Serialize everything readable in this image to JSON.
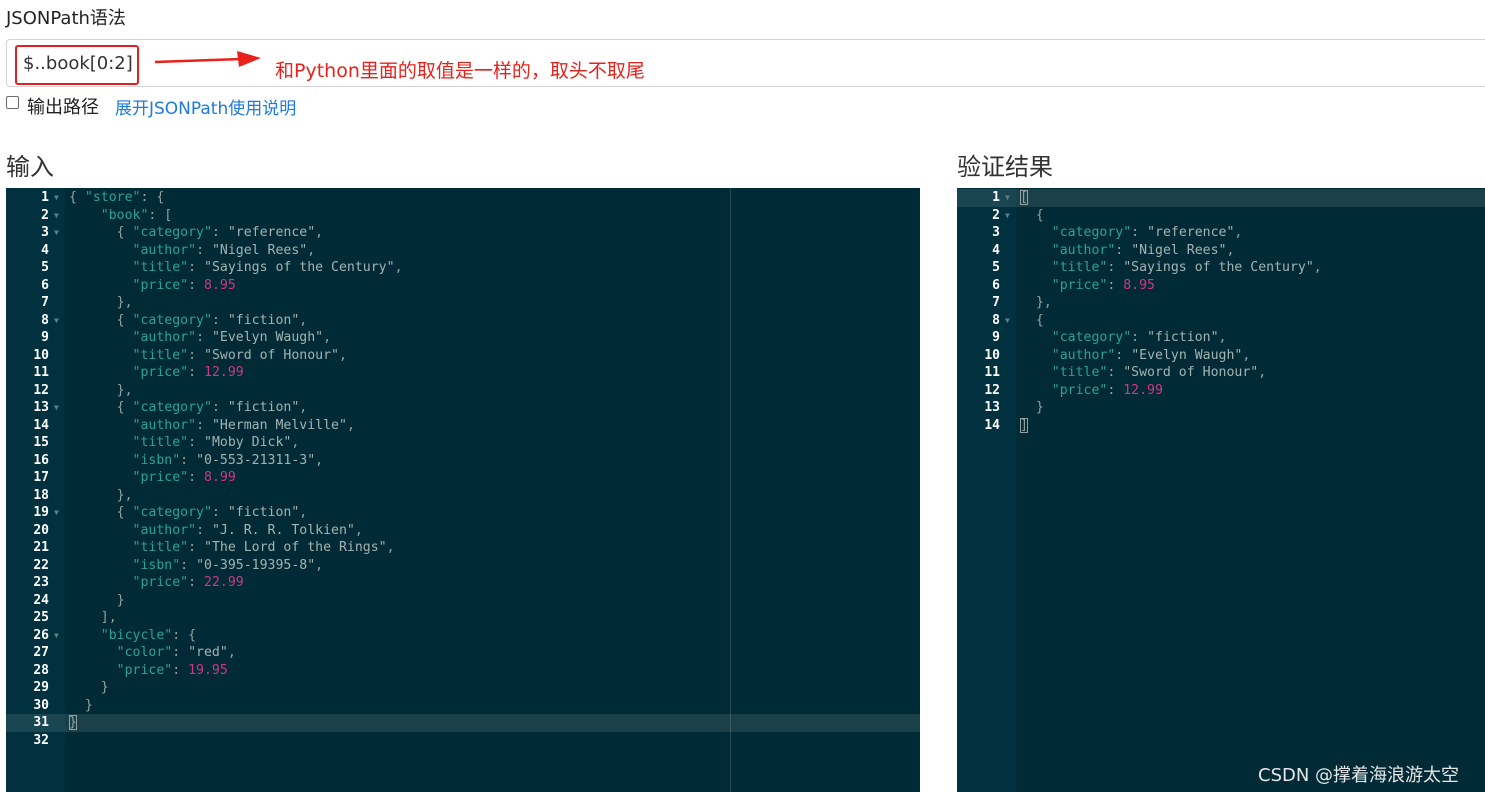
{
  "header": {
    "title": "JSONPath语法"
  },
  "query": {
    "value": "$..book[0:2]"
  },
  "annotation": {
    "text": "和Python里面的取值是一样的，取头不取尾",
    "color": "#e8211b"
  },
  "options": {
    "output_path_label": "输出路径",
    "output_path_checked": false,
    "doc_link": "展开JSONPath使用说明"
  },
  "input_panel": {
    "title": "输入",
    "active_line": 31,
    "lines": [
      [
        {
          "t": "br",
          "v": "{"
        },
        {
          "t": "p",
          "v": " "
        },
        {
          "t": "k",
          "v": "\"store\""
        },
        {
          "t": "p",
          "v": ": {"
        }
      ],
      [
        {
          "t": "p",
          "v": "    "
        },
        {
          "t": "k",
          "v": "\"book\""
        },
        {
          "t": "p",
          "v": ": ["
        }
      ],
      [
        {
          "t": "p",
          "v": "      { "
        },
        {
          "t": "k",
          "v": "\"category\""
        },
        {
          "t": "p",
          "v": ": "
        },
        {
          "t": "s",
          "v": "\"reference\""
        },
        {
          "t": "p",
          "v": ","
        }
      ],
      [
        {
          "t": "p",
          "v": "        "
        },
        {
          "t": "k",
          "v": "\"author\""
        },
        {
          "t": "p",
          "v": ": "
        },
        {
          "t": "s",
          "v": "\"Nigel Rees\""
        },
        {
          "t": "p",
          "v": ","
        }
      ],
      [
        {
          "t": "p",
          "v": "        "
        },
        {
          "t": "k",
          "v": "\"title\""
        },
        {
          "t": "p",
          "v": ": "
        },
        {
          "t": "s",
          "v": "\"Sayings of the Century\""
        },
        {
          "t": "p",
          "v": ","
        }
      ],
      [
        {
          "t": "p",
          "v": "        "
        },
        {
          "t": "k",
          "v": "\"price\""
        },
        {
          "t": "p",
          "v": ": "
        },
        {
          "t": "n",
          "v": "8.95"
        }
      ],
      [
        {
          "t": "p",
          "v": "      },"
        }
      ],
      [
        {
          "t": "p",
          "v": "      { "
        },
        {
          "t": "k",
          "v": "\"category\""
        },
        {
          "t": "p",
          "v": ": "
        },
        {
          "t": "s",
          "v": "\"fiction\""
        },
        {
          "t": "p",
          "v": ","
        }
      ],
      [
        {
          "t": "p",
          "v": "        "
        },
        {
          "t": "k",
          "v": "\"author\""
        },
        {
          "t": "p",
          "v": ": "
        },
        {
          "t": "s",
          "v": "\"Evelyn Waugh\""
        },
        {
          "t": "p",
          "v": ","
        }
      ],
      [
        {
          "t": "p",
          "v": "        "
        },
        {
          "t": "k",
          "v": "\"title\""
        },
        {
          "t": "p",
          "v": ": "
        },
        {
          "t": "s",
          "v": "\"Sword of Honour\""
        },
        {
          "t": "p",
          "v": ","
        }
      ],
      [
        {
          "t": "p",
          "v": "        "
        },
        {
          "t": "k",
          "v": "\"price\""
        },
        {
          "t": "p",
          "v": ": "
        },
        {
          "t": "n",
          "v": "12.99"
        }
      ],
      [
        {
          "t": "p",
          "v": "      },"
        }
      ],
      [
        {
          "t": "p",
          "v": "      { "
        },
        {
          "t": "k",
          "v": "\"category\""
        },
        {
          "t": "p",
          "v": ": "
        },
        {
          "t": "s",
          "v": "\"fiction\""
        },
        {
          "t": "p",
          "v": ","
        }
      ],
      [
        {
          "t": "p",
          "v": "        "
        },
        {
          "t": "k",
          "v": "\"author\""
        },
        {
          "t": "p",
          "v": ": "
        },
        {
          "t": "s",
          "v": "\"Herman Melville\""
        },
        {
          "t": "p",
          "v": ","
        }
      ],
      [
        {
          "t": "p",
          "v": "        "
        },
        {
          "t": "k",
          "v": "\"title\""
        },
        {
          "t": "p",
          "v": ": "
        },
        {
          "t": "s",
          "v": "\"Moby Dick\""
        },
        {
          "t": "p",
          "v": ","
        }
      ],
      [
        {
          "t": "p",
          "v": "        "
        },
        {
          "t": "k",
          "v": "\"isbn\""
        },
        {
          "t": "p",
          "v": ": "
        },
        {
          "t": "s",
          "v": "\"0-553-21311-3\""
        },
        {
          "t": "p",
          "v": ","
        }
      ],
      [
        {
          "t": "p",
          "v": "        "
        },
        {
          "t": "k",
          "v": "\"price\""
        },
        {
          "t": "p",
          "v": ": "
        },
        {
          "t": "n",
          "v": "8.99"
        }
      ],
      [
        {
          "t": "p",
          "v": "      },"
        }
      ],
      [
        {
          "t": "p",
          "v": "      { "
        },
        {
          "t": "k",
          "v": "\"category\""
        },
        {
          "t": "p",
          "v": ": "
        },
        {
          "t": "s",
          "v": "\"fiction\""
        },
        {
          "t": "p",
          "v": ","
        }
      ],
      [
        {
          "t": "p",
          "v": "        "
        },
        {
          "t": "k",
          "v": "\"author\""
        },
        {
          "t": "p",
          "v": ": "
        },
        {
          "t": "s",
          "v": "\"J. R. R. Tolkien\""
        },
        {
          "t": "p",
          "v": ","
        }
      ],
      [
        {
          "t": "p",
          "v": "        "
        },
        {
          "t": "k",
          "v": "\"title\""
        },
        {
          "t": "p",
          "v": ": "
        },
        {
          "t": "s",
          "v": "\"The Lord of the Rings\""
        },
        {
          "t": "p",
          "v": ","
        }
      ],
      [
        {
          "t": "p",
          "v": "        "
        },
        {
          "t": "k",
          "v": "\"isbn\""
        },
        {
          "t": "p",
          "v": ": "
        },
        {
          "t": "s",
          "v": "\"0-395-19395-8\""
        },
        {
          "t": "p",
          "v": ","
        }
      ],
      [
        {
          "t": "p",
          "v": "        "
        },
        {
          "t": "k",
          "v": "\"price\""
        },
        {
          "t": "p",
          "v": ": "
        },
        {
          "t": "n",
          "v": "22.99"
        }
      ],
      [
        {
          "t": "p",
          "v": "      }"
        }
      ],
      [
        {
          "t": "p",
          "v": "    ],"
        }
      ],
      [
        {
          "t": "p",
          "v": "    "
        },
        {
          "t": "k",
          "v": "\"bicycle\""
        },
        {
          "t": "p",
          "v": ": {"
        }
      ],
      [
        {
          "t": "p",
          "v": "      "
        },
        {
          "t": "k",
          "v": "\"color\""
        },
        {
          "t": "p",
          "v": ": "
        },
        {
          "t": "s",
          "v": "\"red\""
        },
        {
          "t": "p",
          "v": ","
        }
      ],
      [
        {
          "t": "p",
          "v": "      "
        },
        {
          "t": "k",
          "v": "\"price\""
        },
        {
          "t": "p",
          "v": ": "
        },
        {
          "t": "n",
          "v": "19.95"
        }
      ],
      [
        {
          "t": "p",
          "v": "    }"
        }
      ],
      [
        {
          "t": "p",
          "v": "  }"
        }
      ],
      [
        {
          "t": "brc",
          "v": "}"
        }
      ],
      []
    ],
    "fold_lines": [
      1,
      2,
      3,
      8,
      13,
      19,
      26
    ]
  },
  "result_panel": {
    "title": "验证结果",
    "active_line": 1,
    "lines": [
      [
        {
          "t": "brc",
          "v": "["
        }
      ],
      [
        {
          "t": "p",
          "v": "  {"
        }
      ],
      [
        {
          "t": "p",
          "v": "    "
        },
        {
          "t": "k",
          "v": "\"category\""
        },
        {
          "t": "p",
          "v": ": "
        },
        {
          "t": "s",
          "v": "\"reference\""
        },
        {
          "t": "p",
          "v": ","
        }
      ],
      [
        {
          "t": "p",
          "v": "    "
        },
        {
          "t": "k",
          "v": "\"author\""
        },
        {
          "t": "p",
          "v": ": "
        },
        {
          "t": "s",
          "v": "\"Nigel Rees\""
        },
        {
          "t": "p",
          "v": ","
        }
      ],
      [
        {
          "t": "p",
          "v": "    "
        },
        {
          "t": "k",
          "v": "\"title\""
        },
        {
          "t": "p",
          "v": ": "
        },
        {
          "t": "s",
          "v": "\"Sayings of the Century\""
        },
        {
          "t": "p",
          "v": ","
        }
      ],
      [
        {
          "t": "p",
          "v": "    "
        },
        {
          "t": "k",
          "v": "\"price\""
        },
        {
          "t": "p",
          "v": ": "
        },
        {
          "t": "n",
          "v": "8.95"
        }
      ],
      [
        {
          "t": "p",
          "v": "  },"
        }
      ],
      [
        {
          "t": "p",
          "v": "  {"
        }
      ],
      [
        {
          "t": "p",
          "v": "    "
        },
        {
          "t": "k",
          "v": "\"category\""
        },
        {
          "t": "p",
          "v": ": "
        },
        {
          "t": "s",
          "v": "\"fiction\""
        },
        {
          "t": "p",
          "v": ","
        }
      ],
      [
        {
          "t": "p",
          "v": "    "
        },
        {
          "t": "k",
          "v": "\"author\""
        },
        {
          "t": "p",
          "v": ": "
        },
        {
          "t": "s",
          "v": "\"Evelyn Waugh\""
        },
        {
          "t": "p",
          "v": ","
        }
      ],
      [
        {
          "t": "p",
          "v": "    "
        },
        {
          "t": "k",
          "v": "\"title\""
        },
        {
          "t": "p",
          "v": ": "
        },
        {
          "t": "s",
          "v": "\"Sword of Honour\""
        },
        {
          "t": "p",
          "v": ","
        }
      ],
      [
        {
          "t": "p",
          "v": "    "
        },
        {
          "t": "k",
          "v": "\"price\""
        },
        {
          "t": "p",
          "v": ": "
        },
        {
          "t": "n",
          "v": "12.99"
        }
      ],
      [
        {
          "t": "p",
          "v": "  }"
        }
      ],
      [
        {
          "t": "brc",
          "v": "]"
        }
      ]
    ],
    "fold_lines": [
      1,
      2,
      8
    ]
  },
  "watermark": {
    "text": "CSDN @撑着海浪游太空"
  },
  "colors": {
    "editor_bg": "#002b36",
    "key": "#2aa198",
    "number": "#d33682",
    "link": "#1e7ae0"
  }
}
